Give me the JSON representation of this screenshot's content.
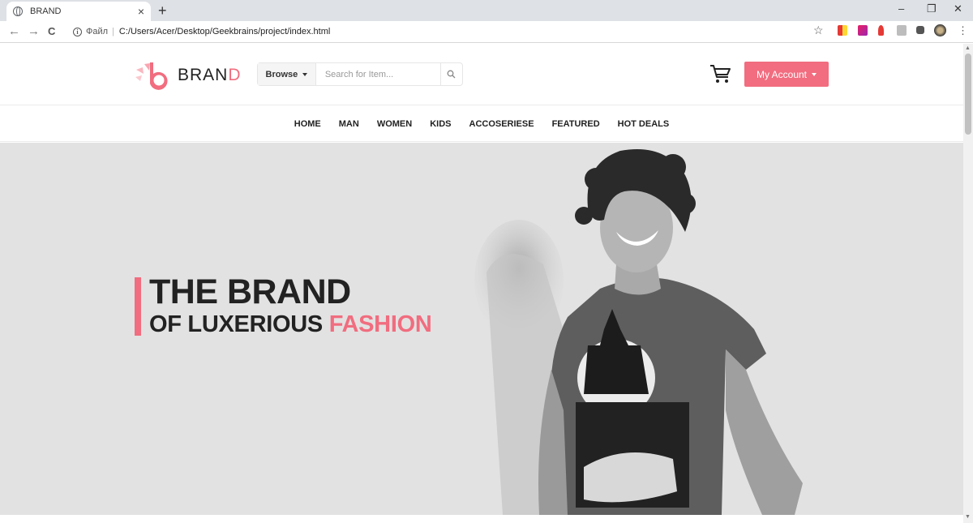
{
  "browser": {
    "tab_title": "BRAND",
    "tab_close": "×",
    "new_tab": "+",
    "scheme_label": "Файл",
    "address": "C:/Users/Acer/Desktop/Geekbrains/project/index.html",
    "nav_back": "←",
    "nav_forward": "→",
    "nav_reload": "C",
    "star": "☆",
    "window_minimize": "–",
    "window_restore": "❐",
    "window_close": "✕"
  },
  "header": {
    "logo_text": "BRAN",
    "logo_accent": "D",
    "browse_label": "Browse",
    "search_placeholder": "Search for Item...",
    "account_label": "My Account"
  },
  "menu": {
    "items": [
      "HOME",
      "MAN",
      "WOMEN",
      "KIDS",
      "ACCOSERIESE",
      "FEATURED",
      "HOT DEALS"
    ]
  },
  "hero": {
    "title": "THE BRAND",
    "subtitle": "OF LUXERIOUS",
    "subtitle_accent": "FASHION"
  },
  "colors": {
    "accent": "#f16d7f",
    "hero_bg": "#e2e2e2",
    "text": "#222222"
  },
  "icons": [
    "globe-icon",
    "close-icon",
    "search-icon",
    "cart-icon",
    "chevron-down-icon",
    "star-icon",
    "info-icon"
  ]
}
